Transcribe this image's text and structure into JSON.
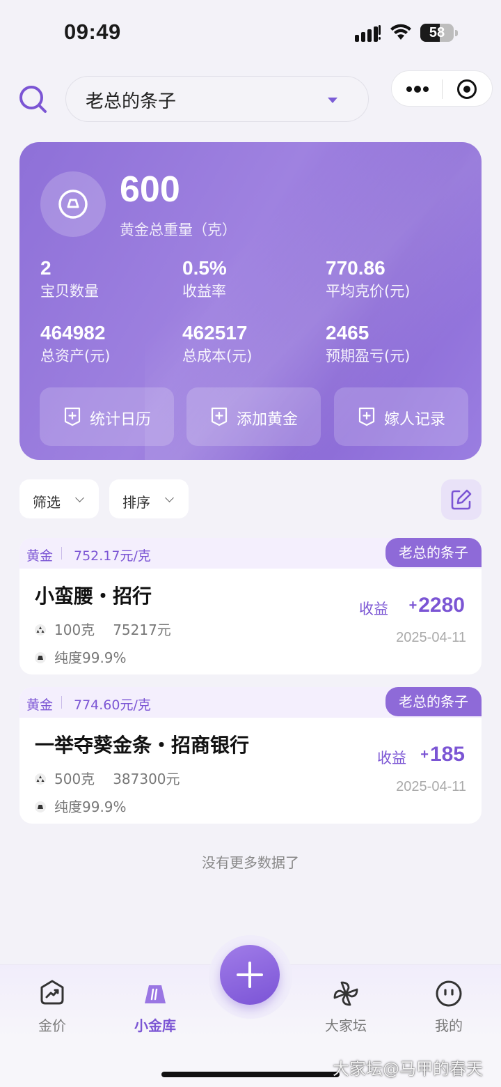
{
  "status_bar": {
    "time": "09:49",
    "battery": "58",
    "battery_level": 0.58
  },
  "header": {
    "account_name": "老总的条子"
  },
  "summary": {
    "total_weight": "600",
    "total_weight_label": "黄金总重量（克）",
    "stats": [
      {
        "value": "2",
        "label": "宝贝数量"
      },
      {
        "value": "0.5%",
        "label": "收益率"
      },
      {
        "value": "770.86",
        "label": "平均克价(元)"
      },
      {
        "value": "464982",
        "label": "总资产(元)"
      },
      {
        "value": "462517",
        "label": "总成本(元)"
      },
      {
        "value": "2465",
        "label": "预期盈亏(元)"
      }
    ],
    "actions": [
      {
        "label": "统计日历"
      },
      {
        "label": "添加黄金"
      },
      {
        "label": "嫁人记录"
      }
    ]
  },
  "filters": {
    "filter_label": "筛选",
    "sort_label": "排序"
  },
  "items": [
    {
      "type": "黄金",
      "unit_price": "752.17元/克",
      "tag": "老总的条子",
      "name": "小蛮腰・招行",
      "weight": "100克",
      "cost": "75217元",
      "purity": "纯度99.9%",
      "profit_label": "收益",
      "profit_sign": "+",
      "profit": "2280",
      "date": "2025-04-11"
    },
    {
      "type": "黄金",
      "unit_price": "774.60元/克",
      "tag": "老总的条子",
      "name": "一举夺葵金条・招商银行",
      "weight": "500克",
      "cost": "387300元",
      "purity": "纯度99.9%",
      "profit_label": "收益",
      "profit_sign": "+",
      "profit": "185",
      "date": "2025-04-11"
    }
  ],
  "list_end": "没有更多数据了",
  "tabbar": {
    "tabs": [
      {
        "label": "金价",
        "icon": "trend-icon"
      },
      {
        "label": "小金库",
        "icon": "gold-bar-icon"
      },
      {
        "label": "大家坛",
        "icon": "pinwheel-icon"
      },
      {
        "label": "我的",
        "icon": "smiley-icon"
      }
    ],
    "add_icon": "plus-icon"
  },
  "watermark": "大家坛@马甲的春天",
  "colors": {
    "accent": "#7b55d4",
    "card": "#9679dc",
    "tag": "#8e6ad8"
  }
}
